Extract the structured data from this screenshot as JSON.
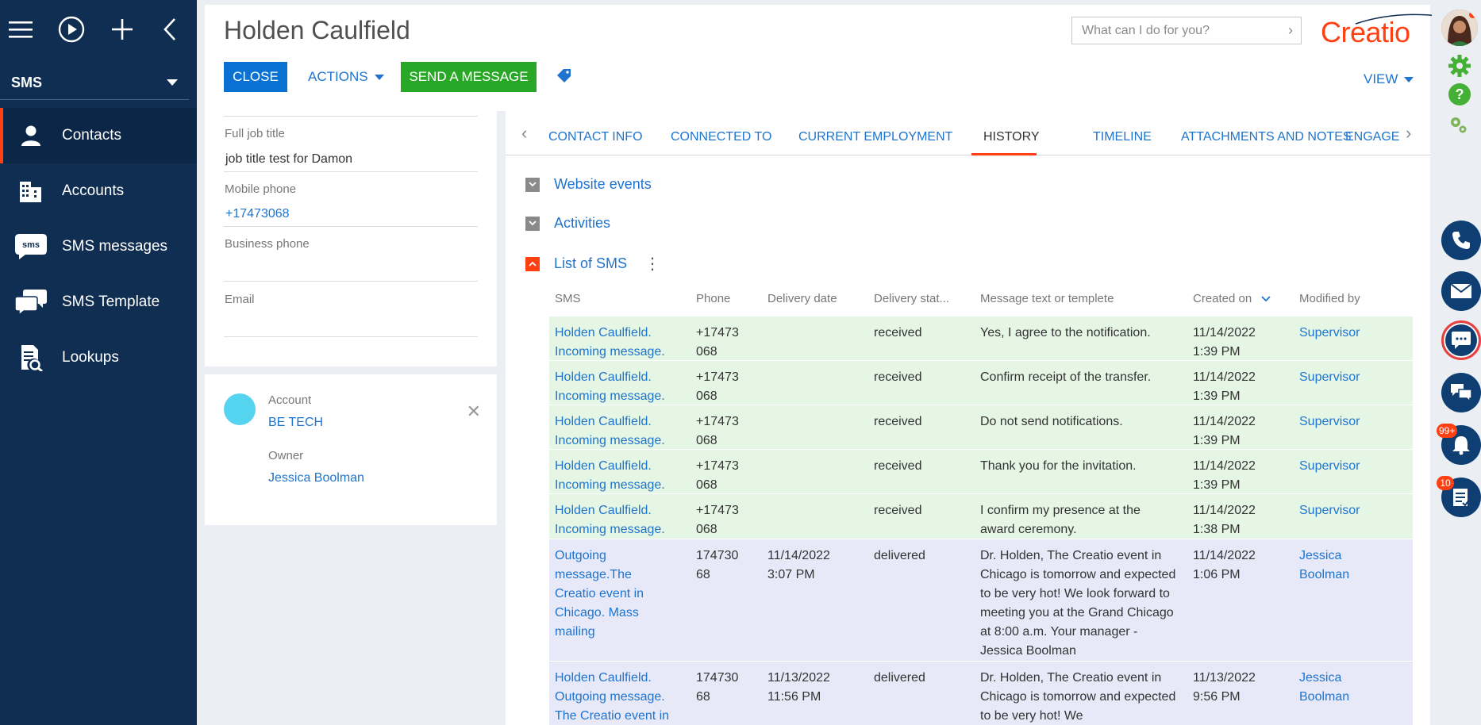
{
  "nav": {
    "workspace": "SMS",
    "items": [
      {
        "label": "Contacts",
        "icon": "person-icon",
        "active": true
      },
      {
        "label": "Accounts",
        "icon": "building-icon",
        "active": false
      },
      {
        "label": "SMS messages",
        "icon": "sms-bubble-icon",
        "active": false
      },
      {
        "label": "SMS Template",
        "icon": "chat-bubbles-icon",
        "active": false
      },
      {
        "label": "Lookups",
        "icon": "lookup-icon",
        "active": false
      }
    ]
  },
  "header": {
    "title": "Holden Caulfield",
    "close_label": "CLOSE",
    "actions_label": "ACTIONS",
    "send_label": "SEND A MESSAGE",
    "search_placeholder": "What can I do for you?",
    "logo": "Creatio",
    "view_label": "VIEW"
  },
  "info": {
    "full_job_title_label": "Full job title",
    "full_job_title": "job title test for Damon",
    "mobile_label": "Mobile phone",
    "mobile": "+17473068",
    "business_label": "Business phone",
    "business": "",
    "email_label": "Email",
    "email": ""
  },
  "account": {
    "account_label": "Account",
    "account": "BE TECH",
    "owner_label": "Owner",
    "owner": "Jessica Boolman"
  },
  "tabs": [
    {
      "label": "CONTACT INFO"
    },
    {
      "label": "CONNECTED TO"
    },
    {
      "label": "CURRENT EMPLOYMENT"
    },
    {
      "label": "HISTORY"
    },
    {
      "label": "TIMELINE"
    },
    {
      "label": "ATTACHMENTS AND NOTES"
    },
    {
      "label": "ENGAGEMENT"
    }
  ],
  "groups": {
    "website": "Website events",
    "activities": "Activities",
    "sms": "List of SMS"
  },
  "grid": {
    "columns": [
      "SMS",
      "Phone",
      "Delivery date",
      "Delivery stat...",
      "Message text or templete",
      "Created on",
      "Modified by"
    ],
    "rows": [
      {
        "sms": "Holden Caulfield. Incoming message.",
        "phone": "+17473 068",
        "delivery_date": "",
        "status": "received",
        "text": "Yes, I agree to the notification.",
        "created": "11/14/2022 1:39 PM",
        "modified": "Supervisor"
      },
      {
        "sms": "Holden Caulfield. Incoming message.",
        "phone": "+17473 068",
        "delivery_date": "",
        "status": "received",
        "text": "Confirm receipt of the transfer.",
        "created": "11/14/2022 1:39 PM",
        "modified": "Supervisor"
      },
      {
        "sms": "Holden Caulfield. Incoming message.",
        "phone": "+17473 068",
        "delivery_date": "",
        "status": "received",
        "text": "Do not send notifications.",
        "created": "11/14/2022 1:39 PM",
        "modified": "Supervisor"
      },
      {
        "sms": "Holden Caulfield. Incoming message.",
        "phone": "+17473 068",
        "delivery_date": "",
        "status": "received",
        "text": "Thank you for the invitation.",
        "created": "11/14/2022 1:39 PM",
        "modified": "Supervisor"
      },
      {
        "sms": "Holden Caulfield. Incoming message.",
        "phone": "+17473 068",
        "delivery_date": "",
        "status": "received",
        "text": "I confirm my presence at the award ceremony.",
        "created": "11/14/2022 1:38 PM",
        "modified": "Supervisor"
      },
      {
        "sms": "Outgoing message.The Creatio event in Chicago. Mass mailing",
        "phone": "174730 68",
        "delivery_date": "11/14/2022 3:07 PM",
        "status": "delivered",
        "text": "Dr. Holden, The Creatio event in Chicago is tomorrow and expected to be very hot! We look forward to meeting you at the Grand Chicago at 8:00 a.m. Your manager - Jessica Boolman",
        "created": "11/14/2022 1:06 PM",
        "modified": "Jessica Boolman"
      },
      {
        "sms": "Holden Caulfield. Outgoing message. The Creatio event in",
        "phone": "174730 68",
        "delivery_date": "11/13/2022 11:56 PM",
        "status": "delivered",
        "text": "Dr. Holden, The Creatio event in Chicago is tomorrow and expected to be very hot! We",
        "created": "11/13/2022 9:56 PM",
        "modified": "Jessica Boolman"
      }
    ]
  },
  "rail": {
    "notifications_badge": "99+",
    "tasks_badge": "10"
  },
  "colors": {
    "nav_bg": "#0f2e52",
    "accent": "#ff4013",
    "primary": "#0a72d2",
    "success": "#29a827",
    "link": "#1e74cf",
    "incoming_row": "#e5f6e4",
    "outgoing_row": "#e7e9f8"
  }
}
